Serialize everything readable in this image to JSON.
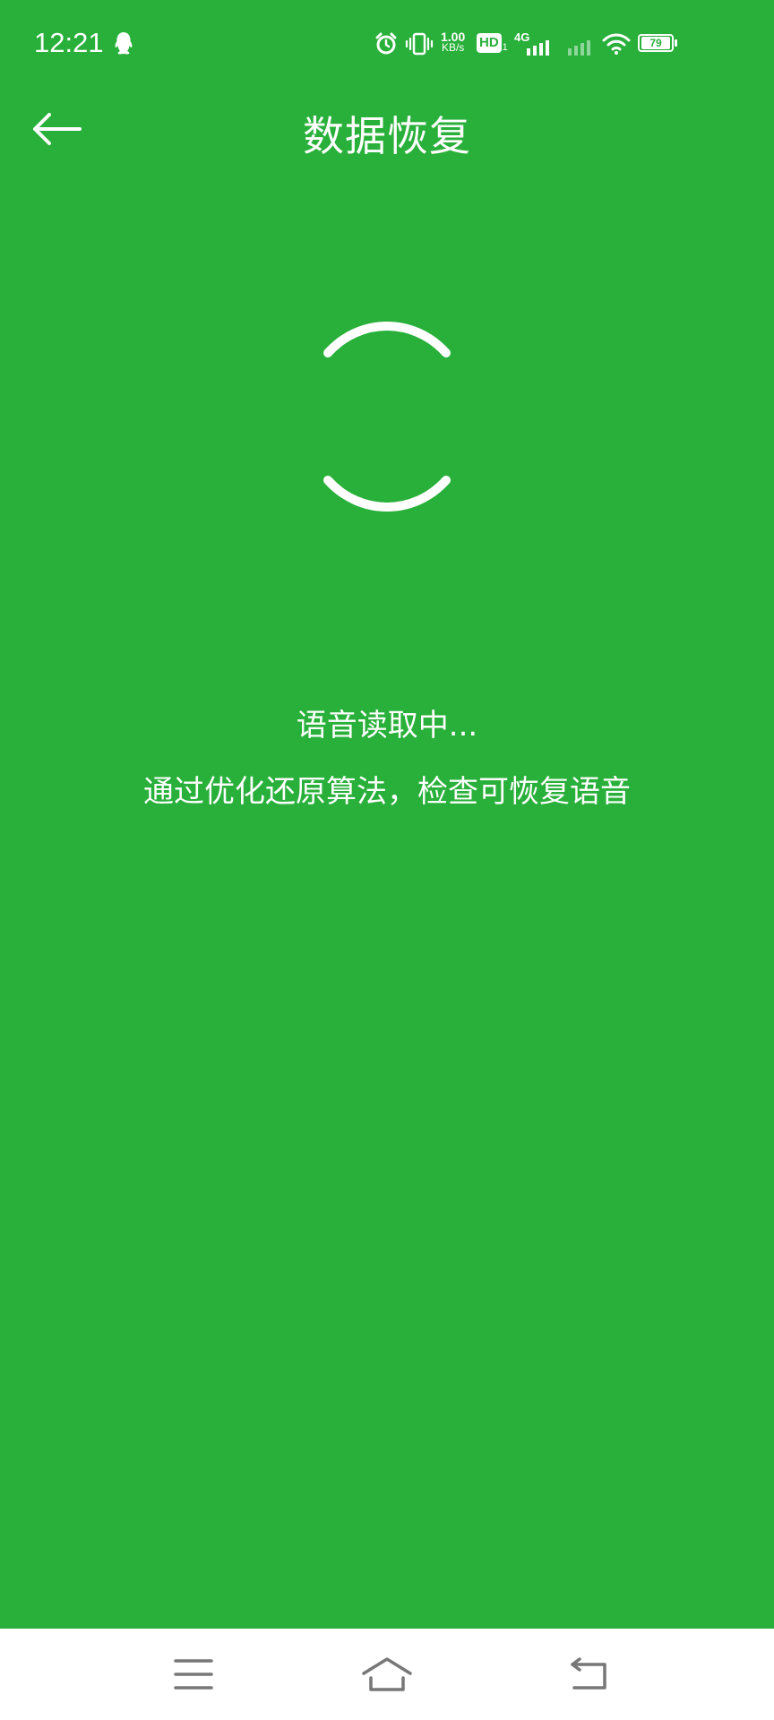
{
  "status_bar": {
    "time": "12:21",
    "net_speed_value": "1.00",
    "net_speed_unit": "KB/s",
    "hd_label": "HD",
    "hd_sub": "1",
    "network_type": "4G",
    "battery_level": "79"
  },
  "toolbar": {
    "title": "数据恢复"
  },
  "main": {
    "status_text": "语音读取中...",
    "detail_text": "通过优化还原算法，检查可恢复语音"
  },
  "colors": {
    "background": "#28b03a",
    "foreground": "#ffffff",
    "nav_bar": "#ffffff",
    "nav_icon": "#777777"
  },
  "icons": {
    "status_left": [
      "qq-penguin-icon"
    ],
    "status_right": [
      "alarm-icon",
      "vibrate-icon",
      "hd-icon",
      "signal-icon",
      "signal-weak-icon",
      "wifi-icon",
      "battery-icon"
    ],
    "toolbar": [
      "back-arrow-icon"
    ],
    "nav": [
      "menu-icon",
      "home-icon",
      "back-icon"
    ]
  }
}
